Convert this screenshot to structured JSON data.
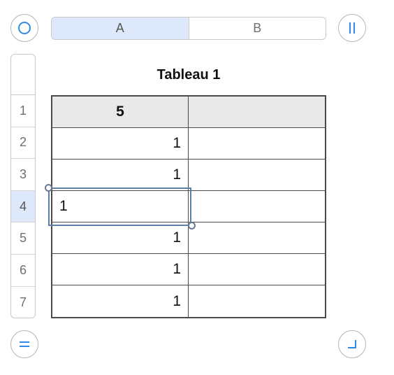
{
  "columns": [
    {
      "label": "A",
      "selected": true
    },
    {
      "label": "B",
      "selected": false
    }
  ],
  "rows": [
    {
      "label": "1",
      "selected": false
    },
    {
      "label": "2",
      "selected": false
    },
    {
      "label": "3",
      "selected": false
    },
    {
      "label": "4",
      "selected": true
    },
    {
      "label": "5",
      "selected": false
    },
    {
      "label": "6",
      "selected": false
    },
    {
      "label": "7",
      "selected": false
    }
  ],
  "table": {
    "title": "Tableau 1",
    "cells": [
      [
        "5",
        ""
      ],
      [
        "1",
        ""
      ],
      [
        "1",
        ""
      ],
      [
        "1",
        ""
      ],
      [
        "1",
        ""
      ],
      [
        "1",
        ""
      ],
      [
        "1",
        ""
      ]
    ]
  },
  "icons": {
    "select_table": "circle-icon",
    "pause_columns": "double-bar-icon",
    "rows_handle": "equals-icon",
    "resize_corner": "corner-icon"
  },
  "colors": {
    "accent": "#2f8ae5",
    "selection_fill": "#dde9fb",
    "selection_border": "#5b7fa6",
    "header_fill": "#e9e9e9"
  }
}
